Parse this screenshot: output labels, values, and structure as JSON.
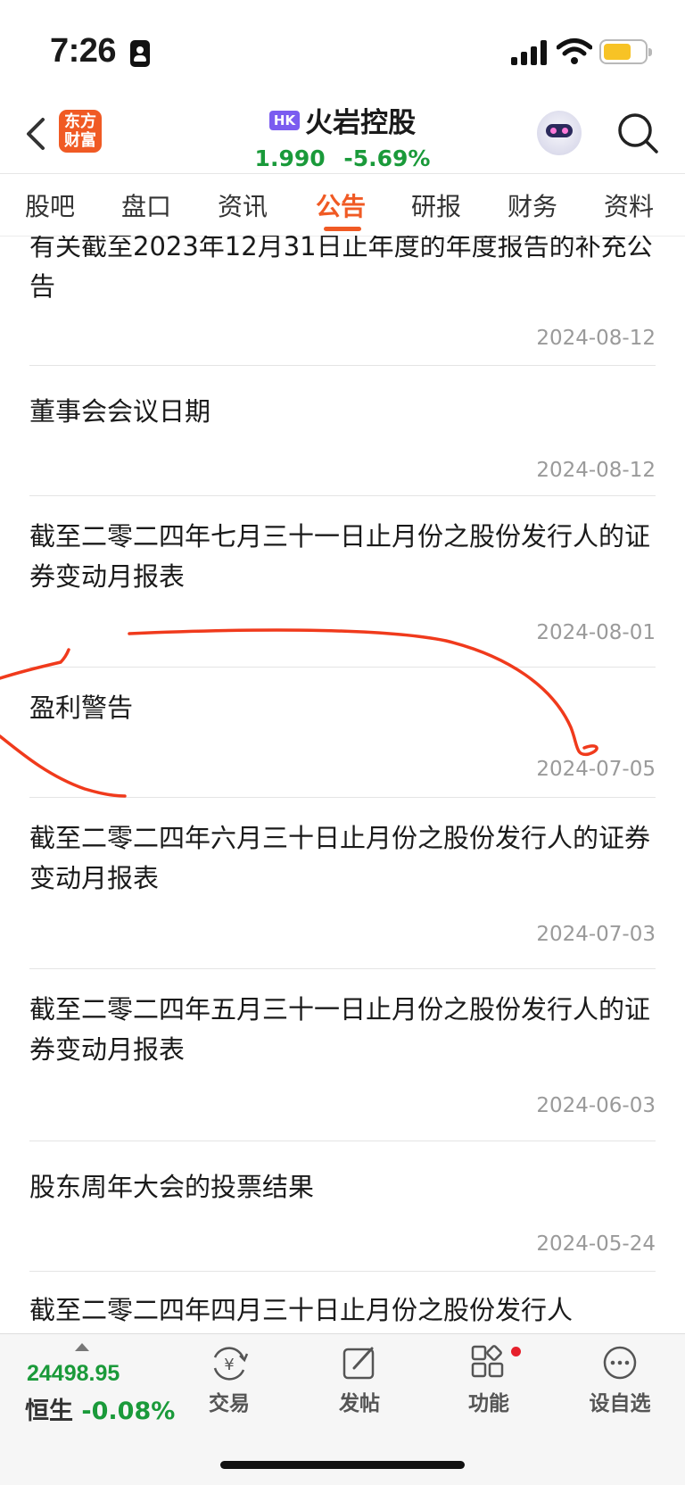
{
  "status_bar": {
    "time": "7:26"
  },
  "header": {
    "logo_text": "东方财富",
    "market_badge": "HK",
    "stock_name": "火岩控股",
    "price": "1.990",
    "change_pct": "-5.69%"
  },
  "tabs": [
    {
      "label": "股吧"
    },
    {
      "label": "盘口"
    },
    {
      "label": "资讯"
    },
    {
      "label": "公告"
    },
    {
      "label": "研报"
    },
    {
      "label": "财务"
    },
    {
      "label": "资料"
    }
  ],
  "active_tab": "公告",
  "announcements": [
    {
      "title": "有关截至2023年12月31日止年度的年度报告的补充公告",
      "date": "2024-08-12"
    },
    {
      "title": "董事会会议日期",
      "date": "2024-08-12"
    },
    {
      "title": "截至二零二四年七月三十一日止月份之股份发行人的证券变动月报表",
      "date": "2024-08-01"
    },
    {
      "title": "盈利警告",
      "date": "2024-07-05"
    },
    {
      "title": "截至二零二四年六月三十日止月份之股份发行人的证券变动月报表",
      "date": "2024-07-03"
    },
    {
      "title": "截至二零二四年五月三十一日止月份之股份发行人的证券变动月报表",
      "date": "2024-06-03"
    },
    {
      "title": "股东周年大会的投票结果",
      "date": "2024-05-24"
    },
    {
      "title": "截至二零二四年四月三十日止月份之股份发行人",
      "date": ""
    }
  ],
  "bottom_bar": {
    "index_value": "24498.95",
    "index_name": "恒生",
    "index_change": "-0.08%",
    "nav": [
      {
        "label": "交易",
        "icon": "trade-yen-icon"
      },
      {
        "label": "发帖",
        "icon": "compose-icon"
      },
      {
        "label": "功能",
        "icon": "grid-icon"
      },
      {
        "label": "设自选",
        "icon": "more-dots-icon"
      }
    ]
  },
  "colors": {
    "accent": "#f05a24",
    "positive_green": "#1a9a3a",
    "hk_badge": "#7b5cf0",
    "annotation_red": "#f03a1c"
  }
}
